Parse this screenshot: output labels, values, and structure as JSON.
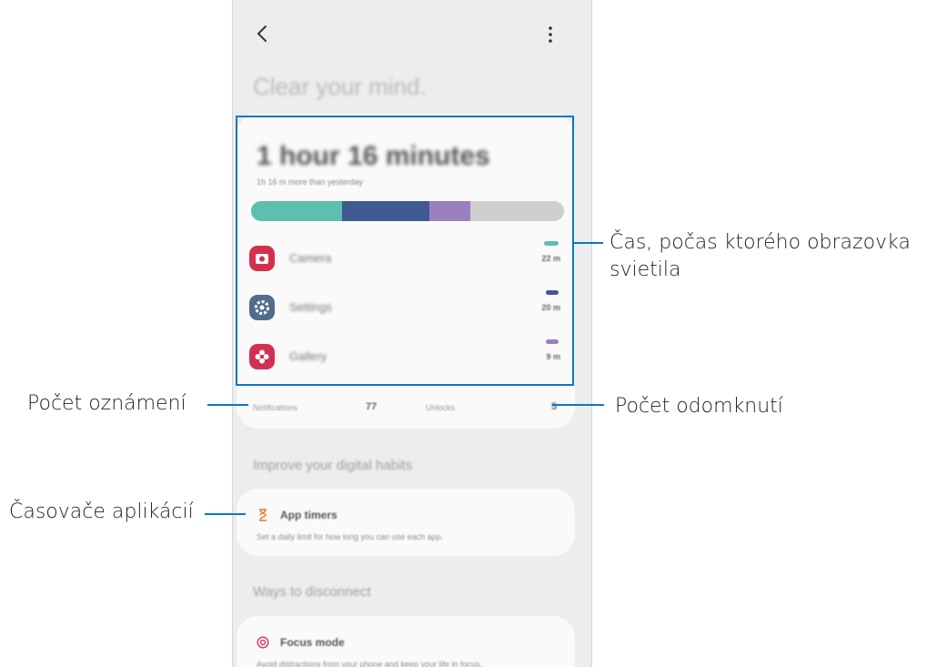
{
  "screen": {
    "headline": "Clear your mind.",
    "screen_time": "1 hour 16 minutes",
    "comparison": "1h 16 m more than yesterday"
  },
  "usage_bar": [
    {
      "app": "Camera",
      "color": "#5dbfad",
      "fraction": 0.29
    },
    {
      "app": "Settings",
      "color": "#3f5a91",
      "fraction": 0.28
    },
    {
      "app": "Gallery",
      "color": "#9b80be",
      "fraction": 0.13
    },
    {
      "app": "Other",
      "color": "#cfcfcf",
      "fraction": 0.3
    }
  ],
  "apps": [
    {
      "name": "Camera",
      "time": "22 m",
      "icon": "camera-icon",
      "icon_color": "#d62f4c",
      "bar_color": "#5dbfad"
    },
    {
      "name": "Settings",
      "time": "20 m",
      "icon": "gear-icon",
      "icon_color": "#4f6d8c",
      "bar_color": "#3f5a91"
    },
    {
      "name": "Gallery",
      "time": "9 m",
      "icon": "flower-icon",
      "icon_color": "#d23052",
      "bar_color": "#9b80be"
    }
  ],
  "stats": {
    "notifications_label": "Notifications",
    "notifications_value": "77",
    "unlocks_label": "Unlocks",
    "unlocks_value": "5"
  },
  "sections": {
    "improve_title": "Improve your digital habits",
    "app_timers_title": "App timers",
    "app_timers_desc": "Set a daily limit for how long you can use each app.",
    "ways_title": "Ways to disconnect",
    "focus_title": "Focus mode",
    "focus_desc": "Avoid distractions from your phone and keep your life in focus."
  },
  "callouts": {
    "screen_time": "Čas, počas ktorého obrazovka",
    "screen_time_line2": "svietila",
    "notifications": "Počet oznámení",
    "unlocks": "Počet odomknutí",
    "app_timers": "Časovače aplikácií"
  },
  "colors": {
    "accent": "#0d76c7",
    "timer_icon": "#e27a2b",
    "focus_icon": "#d63a5b"
  }
}
